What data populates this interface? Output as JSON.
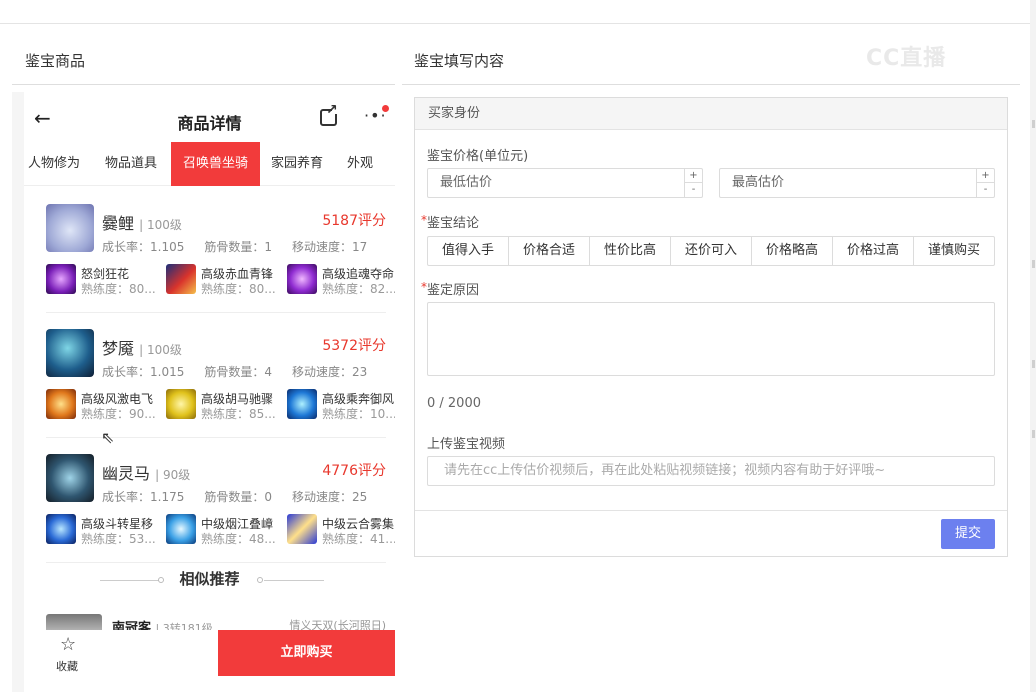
{
  "left_title": "鉴宝商品",
  "right_title": "鉴宝填写内容",
  "watermark": "CC直播",
  "phone": {
    "nav_title": "商品详情",
    "tabs": [
      "人物修为",
      "物品道具",
      "召唤兽坐骑",
      "家园养育",
      "外观"
    ],
    "active_tab": "召唤兽坐骑",
    "pets": [
      {
        "name": "爨鲤",
        "level": "100级",
        "score": "5187评分",
        "growth": "成长率：1.105",
        "bones": "筋骨数量：1",
        "speed": "移动速度：17",
        "skills": [
          {
            "name": "怒剑狂花",
            "prof": "熟练度：80..."
          },
          {
            "name": "高级赤血青锋",
            "prof": "熟练度：80..."
          },
          {
            "name": "高级追魂夺命",
            "prof": "熟练度：82..."
          }
        ]
      },
      {
        "name": "梦魇",
        "level": "100级",
        "score": "5372评分",
        "growth": "成长率：1.015",
        "bones": "筋骨数量：4",
        "speed": "移动速度：23",
        "skills": [
          {
            "name": "高级风激电飞",
            "prof": "熟练度：90..."
          },
          {
            "name": "高级胡马驰骤",
            "prof": "熟练度：85..."
          },
          {
            "name": "高级乘奔御风",
            "prof": "熟练度：10..."
          }
        ]
      },
      {
        "name": "幽灵马",
        "level": "90级",
        "score": "4776评分",
        "growth": "成长率：1.175",
        "bones": "筋骨数量：0",
        "speed": "移动速度：25",
        "skills": [
          {
            "name": "高级斗转星移",
            "prof": "熟练度：53..."
          },
          {
            "name": "中级烟江叠嶂",
            "prof": "熟练度：48..."
          },
          {
            "name": "中级云合雾集",
            "prof": "熟练度：41..."
          }
        ]
      }
    ],
    "similar_title": "相似推荐",
    "rec": {
      "name": "南冠客",
      "meta": "3转181级",
      "server": "情义天双(长河照日)"
    },
    "fav_label": "收藏",
    "buy_label": "立即购买"
  },
  "form": {
    "header": "买家身份",
    "price_label": "鉴宝价格(单位元)",
    "min_placeholder": "最低估价",
    "max_placeholder": "最高估价",
    "conclusion_label": "鉴宝结论",
    "conclusion_options": [
      "值得入手",
      "价格合适",
      "性价比高",
      "还价可入",
      "价格略高",
      "价格过高",
      "谨慎购买"
    ],
    "reason_label": "鉴定原因",
    "counter": "0 / 2000",
    "video_label": "上传鉴宝视频",
    "video_placeholder": "请先在cc上传估价视频后，再在此处粘贴视频链接；视频内容有助于好评哦~",
    "submit": "提交"
  },
  "colors": {
    "accent_red": "#f23b3b",
    "score_red": "#e8382d",
    "submit_blue": "#6c80ef"
  }
}
